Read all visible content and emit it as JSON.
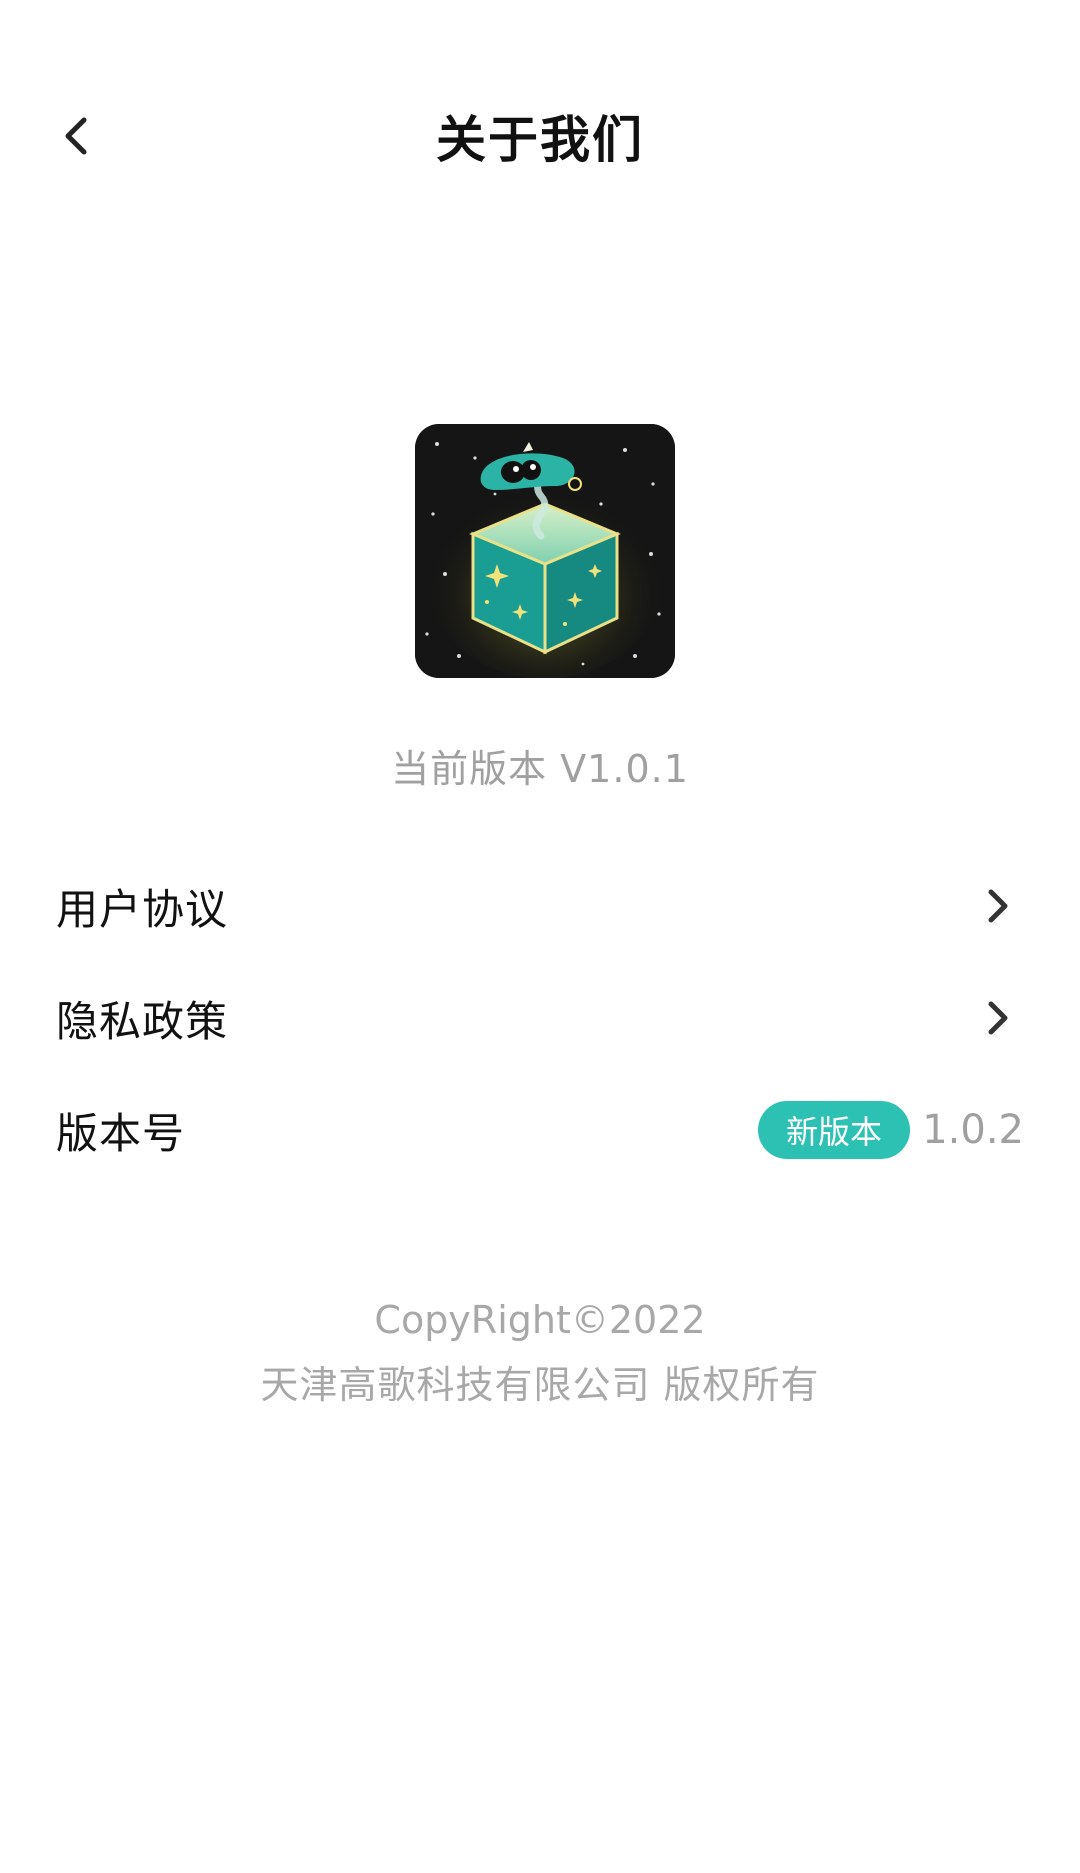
{
  "header": {
    "title": "关于我们"
  },
  "app": {
    "current_version_text": "当前版本 V1.0.1"
  },
  "menu": {
    "items": [
      {
        "label": "用户协议"
      },
      {
        "label": "隐私政策"
      }
    ],
    "version_row": {
      "label": "版本号",
      "badge": "新版本",
      "value": "1.0.2"
    }
  },
  "footer": {
    "copyright": "CopyRight©2022",
    "company": "天津高歌科技有限公司 版权所有"
  },
  "colors": {
    "accent": "#2cc1b3",
    "muted_text": "#a0a0a0",
    "primary_text": "#111111"
  }
}
